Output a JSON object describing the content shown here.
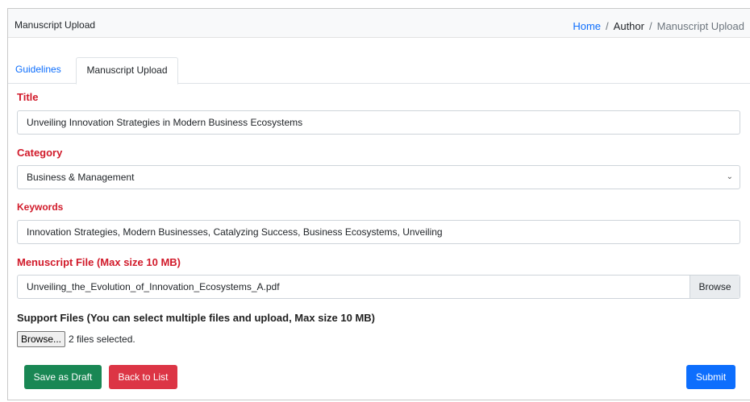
{
  "header": {
    "title": "Manuscript Upload",
    "breadcrumb": {
      "home": "Home",
      "separator": "/",
      "author": "Author",
      "current": "Manuscript Upload"
    }
  },
  "tabs": [
    {
      "label": "Guidelines",
      "active": false
    },
    {
      "label": "Manuscript Upload",
      "active": true
    }
  ],
  "form": {
    "title": {
      "label": "Title",
      "value": "Unveiling Innovation Strategies in Modern Business Ecosystems"
    },
    "category": {
      "label": "Category",
      "value": "Business & Management"
    },
    "keywords": {
      "label": "Keywords",
      "value": "Innovation Strategies, Modern Businesses, Catalyzing Success, Business Ecosystems, Unveiling"
    },
    "manuscript_file": {
      "label": "Menuscript File (Max size 10 MB)",
      "file_name": "Unveiling_the_Evolution_of_Innovation_Ecosystems_A.pdf",
      "browse_label": "Browse"
    },
    "support_files": {
      "label": "Support Files (You can select multiple files and upload, Max size 10 MB)",
      "browse_label": "Browse...",
      "status": "2 files selected."
    }
  },
  "actions": {
    "save_draft": "Save as Draft",
    "back_to_list": "Back to List",
    "submit": "Submit"
  },
  "colors": {
    "primary": "#0d6efd",
    "success": "#198754",
    "danger": "#dc3545",
    "label_red": "#d11a2a"
  },
  "icons": {
    "select_caret": "chevron-down-icon"
  }
}
